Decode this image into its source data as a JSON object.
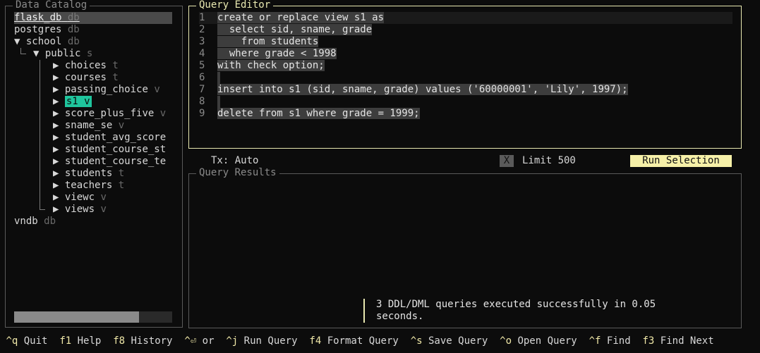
{
  "catalog": {
    "title": "Data Catalog",
    "databases": [
      {
        "name": "flask_db",
        "kind": "db"
      },
      {
        "name": "postgres",
        "kind": "db"
      },
      {
        "name": "school",
        "kind": "db",
        "arrow": "▼"
      },
      {
        "name": "vndb",
        "kind": "db"
      }
    ],
    "schema": {
      "name": "public",
      "kind": "s",
      "arrow": "▼"
    },
    "items": [
      {
        "arrow": "▶",
        "name": "choices",
        "kind": "t"
      },
      {
        "arrow": "▶",
        "name": "courses",
        "kind": "t"
      },
      {
        "arrow": "▶",
        "name": "passing_choice",
        "kind": "v"
      },
      {
        "arrow": "▶",
        "name": "s1",
        "kind": "v"
      },
      {
        "arrow": "▶",
        "name": "score_plus_five",
        "kind": "v"
      },
      {
        "arrow": "▶",
        "name": "sname_se",
        "kind": "v"
      },
      {
        "arrow": "▶",
        "name": "student_avg_score",
        "kind": ""
      },
      {
        "arrow": "▶",
        "name": "student_course_st",
        "kind": ""
      },
      {
        "arrow": "▶",
        "name": "student_course_te",
        "kind": ""
      },
      {
        "arrow": "▶",
        "name": "students",
        "kind": "t"
      },
      {
        "arrow": "▶",
        "name": "teachers",
        "kind": "t"
      },
      {
        "arrow": "▶",
        "name": "viewc",
        "kind": "v"
      },
      {
        "arrow": "▶",
        "name": "views",
        "kind": "v"
      }
    ],
    "scroll_fraction": 0.79
  },
  "editor": {
    "title": "Query Editor",
    "lines": [
      {
        "num": "1",
        "text": "create or replace view s1 as"
      },
      {
        "num": "2",
        "text": "  select sid, sname, grade"
      },
      {
        "num": "3",
        "text": "    from students"
      },
      {
        "num": "4",
        "text": "  where grade < 1998"
      },
      {
        "num": "5",
        "text": "with check option;"
      },
      {
        "num": "6",
        "text": ""
      },
      {
        "num": "7",
        "text": "insert into s1 (sid, sname, grade) values ('60000001', 'Lily', 1997);"
      },
      {
        "num": "8",
        "text": ""
      },
      {
        "num": "9",
        "text": "delete from s1 where grade = 1999;"
      }
    ]
  },
  "toolbar": {
    "tx": "Tx: Auto",
    "limit_check": "X",
    "limit": "Limit 500",
    "run_selection": "Run Selection"
  },
  "results": {
    "title": "Query Results",
    "status": "3 DDL/DML queries executed successfully in 0.05 seconds."
  },
  "footer": [
    {
      "key": "^q",
      "action": "Quit"
    },
    {
      "key": "f1",
      "action": "Help"
    },
    {
      "key": "f8",
      "action": "History"
    },
    {
      "key": "^⏎",
      "action": "or"
    },
    {
      "key": "^j",
      "action": "Run Query"
    },
    {
      "key": "f4",
      "action": "Format Query"
    },
    {
      "key": "^s",
      "action": "Save Query"
    },
    {
      "key": "^o",
      "action": "Open Query"
    },
    {
      "key": "^f",
      "action": "Find"
    },
    {
      "key": "f3",
      "action": "Find Next"
    }
  ],
  "colors": {
    "accent_yellow": "#f6f0a8",
    "selected_teal": "#1fc59d",
    "background": "#0c0c0c"
  }
}
